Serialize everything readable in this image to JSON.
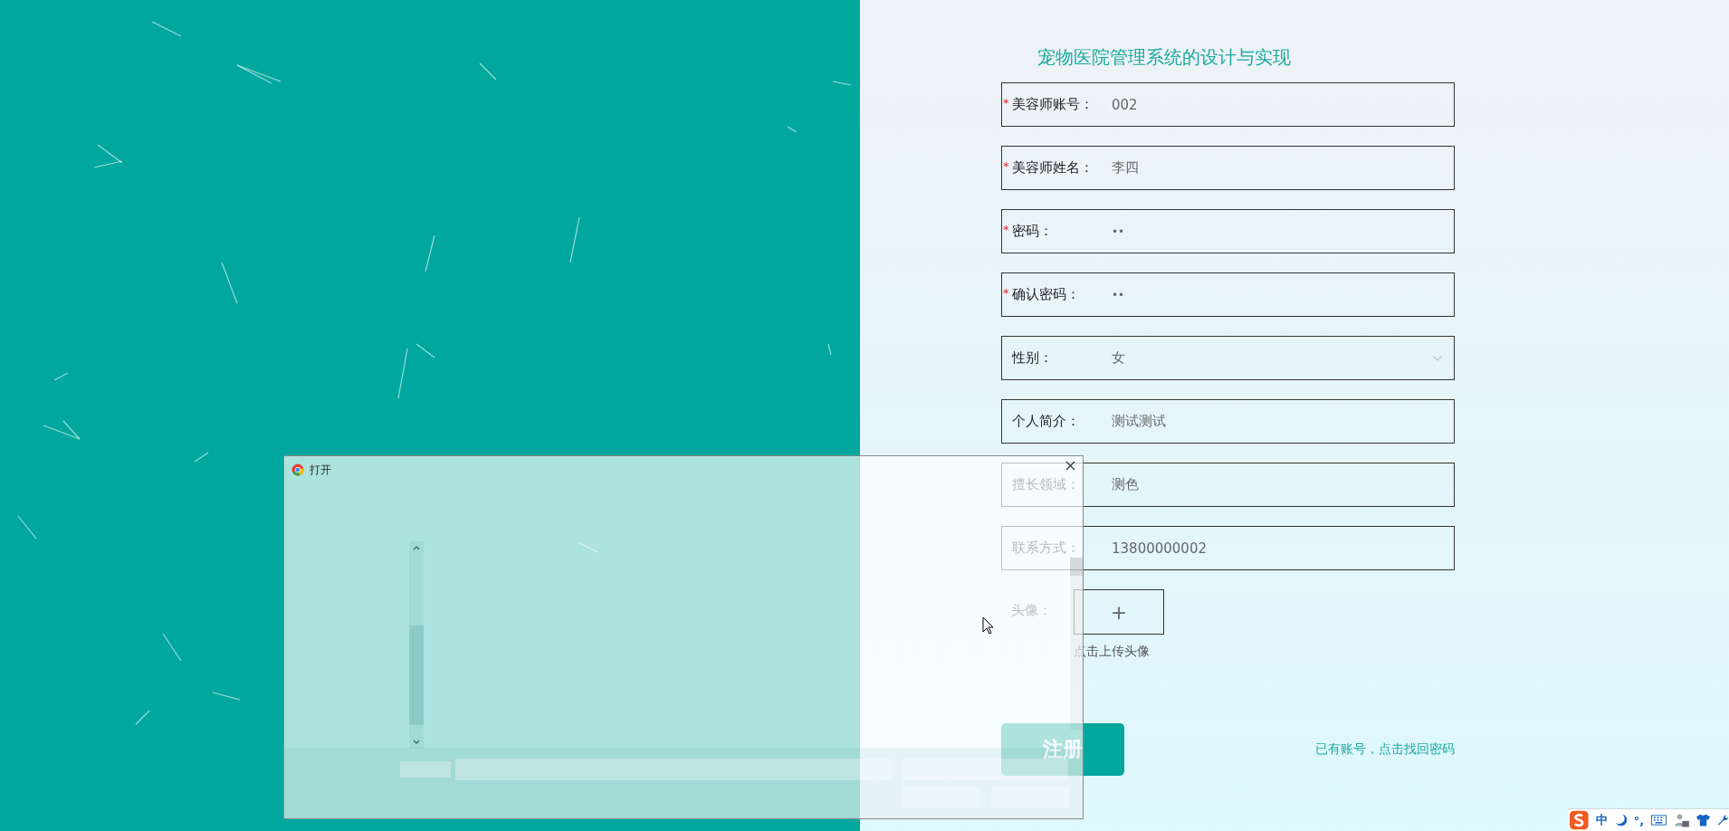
{
  "title": "宠物医院管理系统的设计与实现",
  "fields": [
    {
      "label": "美容师账号：",
      "required_mark": "*",
      "kind": "text",
      "value": "002"
    },
    {
      "label": "美容师姓名：",
      "required_mark": "*",
      "kind": "text",
      "value": "李四"
    },
    {
      "label": "密码：",
      "required_mark": "*",
      "kind": "password",
      "value": "••"
    },
    {
      "label": "确认密码：",
      "required_mark": "*",
      "kind": "password",
      "value": "••"
    },
    {
      "label": "性别：",
      "kind": "select",
      "value": "女"
    },
    {
      "label": "个人简介：",
      "kind": "text",
      "value": "测试测试"
    },
    {
      "label": "擅长领域：",
      "kind": "text",
      "value": "测色"
    },
    {
      "label": "联系方式：",
      "kind": "text",
      "value": "13800000002"
    },
    {
      "label": "头像：",
      "kind": "upload",
      "button": "+",
      "hint": "点击上传头像"
    }
  ],
  "submit_button": "注册",
  "link": "已有账号，点击找回密码",
  "dialog": {
    "title": "打开"
  },
  "ime_toolbar": {
    "items": [
      {
        "kind": "logo"
      },
      {
        "kind": "text",
        "text": "中"
      },
      {
        "kind": "moon"
      },
      {
        "kind": "text",
        "text": "°,"
      },
      {
        "kind": "keyboard"
      },
      {
        "kind": "person"
      },
      {
        "kind": "shirt"
      },
      {
        "kind": "wrench"
      }
    ]
  }
}
